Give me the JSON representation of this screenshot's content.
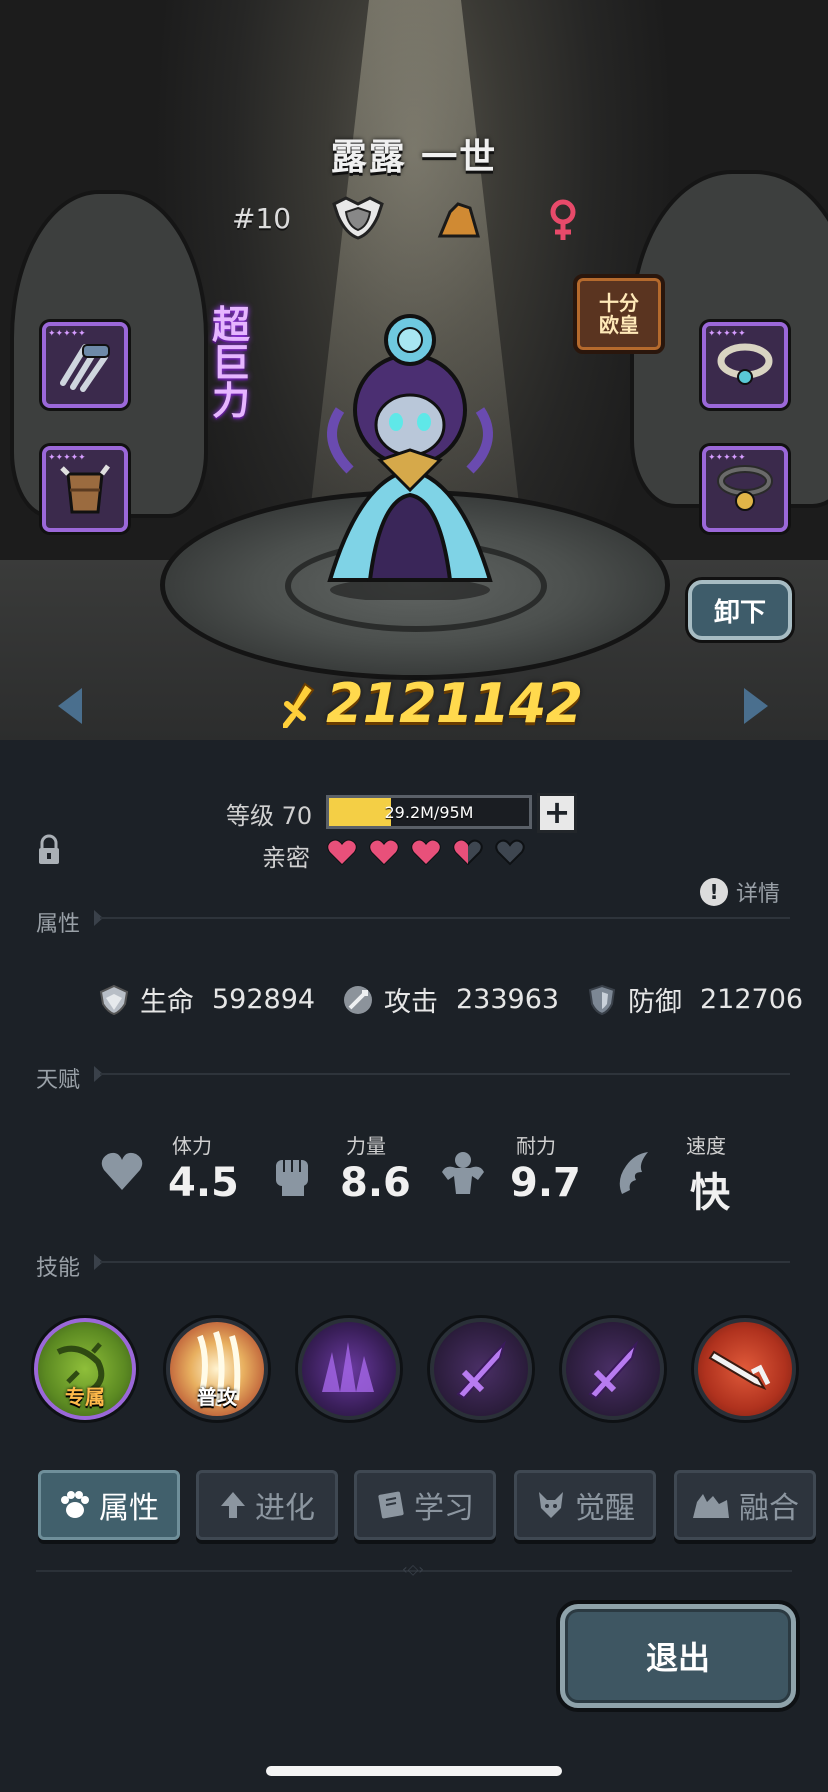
{
  "hero": {
    "name": "露露 一世",
    "rank": "#10",
    "rarity_tag_line1": "十分",
    "rarity_tag_line2": "欧皇",
    "trait_label": "超巨力",
    "power": "2121142"
  },
  "actions": {
    "unequip": "卸下",
    "exit": "退出"
  },
  "level": {
    "label": "等级 70",
    "xp_text": "29.2M/95M",
    "xp_fraction": 0.31
  },
  "intimacy": {
    "label": "亲密",
    "hearts": 5,
    "filled": 3.5
  },
  "sections": {
    "attributes": "属性",
    "talents": "天赋",
    "skills": "技能",
    "details": "详情"
  },
  "stats": [
    {
      "label": "生命",
      "value": "592894",
      "icon": "heart-shield-icon"
    },
    {
      "label": "攻击",
      "value": "233963",
      "icon": "sword-icon"
    },
    {
      "label": "防御",
      "value": "212706",
      "icon": "shield-icon"
    }
  ],
  "talents": [
    {
      "name": "体力",
      "value": "4.5",
      "icon": "heart-icon"
    },
    {
      "name": "力量",
      "value": "8.6",
      "icon": "fist-icon"
    },
    {
      "name": "耐力",
      "value": "9.7",
      "icon": "muscle-icon"
    },
    {
      "name": "速度",
      "value": "快",
      "icon": "wing-icon"
    }
  ],
  "skills": [
    {
      "tag": "专属",
      "icon": "thorn-nature-icon"
    },
    {
      "tag": "普攻",
      "icon": "claw-slash-icon"
    },
    {
      "tag": "",
      "icon": "purple-spikes-icon"
    },
    {
      "tag": "",
      "icon": "purple-dagger-icon"
    },
    {
      "tag": "",
      "icon": "purple-dagger-icon"
    },
    {
      "tag": "",
      "icon": "sword-strike-icon"
    }
  ],
  "tabs": [
    {
      "label": "属性",
      "icon": "paw-icon",
      "active": true
    },
    {
      "label": "进化",
      "icon": "arrow-up-icon",
      "active": false
    },
    {
      "label": "学习",
      "icon": "book-icon",
      "active": false
    },
    {
      "label": "觉醒",
      "icon": "wolf-head-icon",
      "active": false
    },
    {
      "label": "融合",
      "icon": "beast-merge-icon",
      "active": false
    }
  ],
  "colors": {
    "power": "#ffd94d",
    "rarity_border": "#9b68d9",
    "heart_pink": "#e8507a",
    "xp_fill": "#f4cf45"
  }
}
